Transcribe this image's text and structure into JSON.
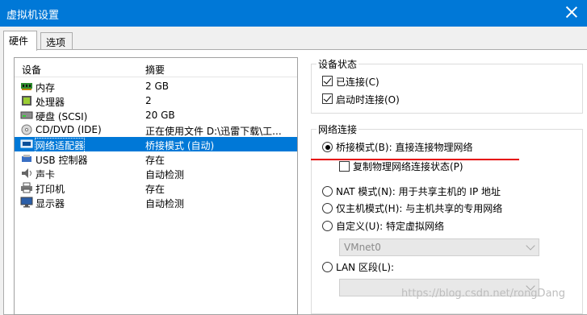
{
  "window": {
    "title": "虚拟机设置"
  },
  "tabs": [
    {
      "label": "硬件",
      "active": true
    },
    {
      "label": "选项",
      "active": false
    }
  ],
  "device_list": {
    "headers": {
      "device": "设备",
      "summary": "摘要"
    },
    "rows": [
      {
        "icon": "memory-icon",
        "name": "内存",
        "summary": "2 GB"
      },
      {
        "icon": "processor-icon",
        "name": "处理器",
        "summary": "2"
      },
      {
        "icon": "hard-disk-icon",
        "name": "硬盘 (SCSI)",
        "summary": "20 GB"
      },
      {
        "icon": "cd-dvd-icon",
        "name": "CD/DVD (IDE)",
        "summary": "正在使用文件 D:\\迅雷下载\\工..."
      },
      {
        "icon": "network-adapter-icon",
        "name": "网络适配器",
        "summary": "桥接模式 (自动)",
        "selected": true
      },
      {
        "icon": "usb-icon",
        "name": "USB 控制器",
        "summary": "存在"
      },
      {
        "icon": "sound-card-icon",
        "name": "声卡",
        "summary": "自动检测"
      },
      {
        "icon": "printer-icon",
        "name": "打印机",
        "summary": "存在"
      },
      {
        "icon": "display-icon",
        "name": "显示器",
        "summary": "自动检测"
      }
    ]
  },
  "device_status": {
    "title": "设备状态",
    "connected": {
      "label": "已连接(C)",
      "checked": true
    },
    "connect_on_power_on": {
      "label": "启动时连接(O)",
      "checked": true
    }
  },
  "network_connection": {
    "title": "网络连接",
    "bridged": {
      "label": "桥接模式(B): 直接连接物理网络",
      "selected": true
    },
    "replicate": {
      "label": "复制物理网络连接状态(P)",
      "checked": false
    },
    "nat": {
      "label": "NAT 模式(N): 用于共享主机的 IP 地址",
      "selected": false
    },
    "host_only": {
      "label": "仅主机模式(H): 与主机共享的专用网络",
      "selected": false
    },
    "custom": {
      "label": "自定义(U): 特定虚拟网络",
      "selected": false
    },
    "custom_select": {
      "value": "VMnet0"
    },
    "lan_segment": {
      "label": "LAN 区段(L):",
      "selected": false
    },
    "lan_select": {
      "value": ""
    }
  },
  "watermark": "https://blog.csdn.net/rongDang",
  "colors": {
    "titlebar": "#0078d7",
    "selection": "#0078d7",
    "annotation": "#e60000"
  }
}
